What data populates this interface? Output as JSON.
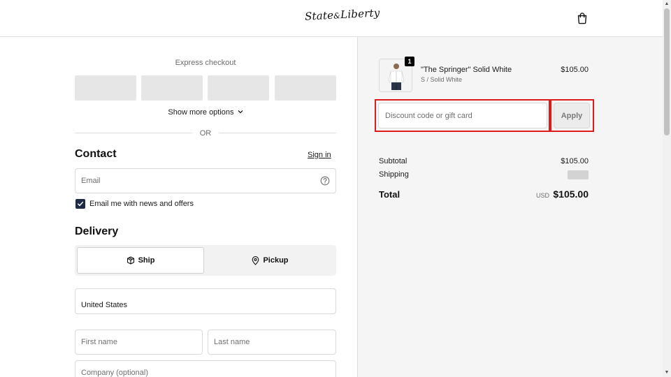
{
  "header": {
    "logo_text_1": "State",
    "logo_text_amp": "&",
    "logo_text_2": "Liberty",
    "cart_icon": "shopping-bag-icon"
  },
  "express": {
    "label": "Express checkout",
    "show_more": "Show more options",
    "or_text": "OR"
  },
  "contact": {
    "title": "Contact",
    "sign_in": "Sign in",
    "email_placeholder": "Email",
    "newsletter_label": "Email me with news and offers",
    "newsletter_checked": true
  },
  "delivery": {
    "title": "Delivery",
    "options": [
      {
        "label": "Ship",
        "icon": "package-icon",
        "selected": true
      },
      {
        "label": "Pickup",
        "icon": "location-pin-icon",
        "selected": false
      }
    ],
    "country_value": "United States",
    "first_name_placeholder": "First name",
    "last_name_placeholder": "Last name",
    "company_placeholder": "Company (optional)"
  },
  "order": {
    "item": {
      "name": "\"The Springer\" Solid White",
      "variant": "S / Solid White",
      "price": "$105.00",
      "quantity": "1"
    },
    "discount_placeholder": "Discount code or gift card",
    "apply_label": "Apply",
    "subtotal_label": "Subtotal",
    "subtotal_value": "$105.00",
    "shipping_label": "Shipping",
    "total_label": "Total",
    "total_currency": "USD",
    "total_value": "$105.00"
  },
  "colors": {
    "highlight_outline": "#e01b1b",
    "checkbox": "#1f2a44",
    "summary_background": "#f5f5f5"
  }
}
